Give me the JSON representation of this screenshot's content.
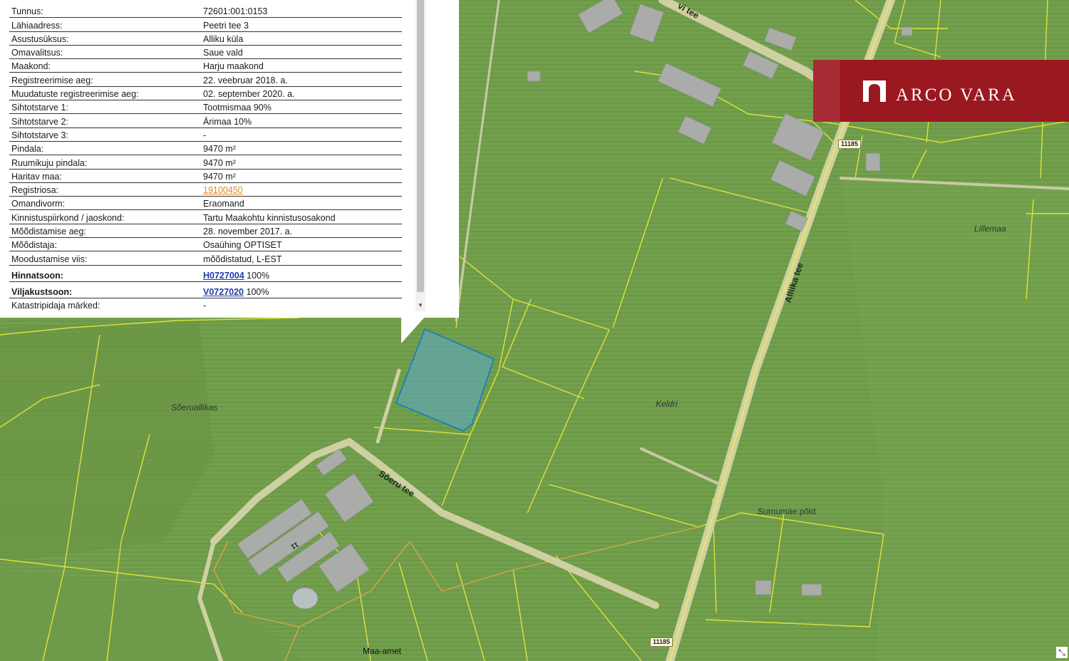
{
  "popup": {
    "rows": [
      {
        "key": "Tunnus:",
        "value": "72601:001:0153"
      },
      {
        "key": "Lähiaadress:",
        "value": "Peetri tee 3"
      },
      {
        "key": "Asustusüksus:",
        "value": "Alliku küla"
      },
      {
        "key": "Omavalitsus:",
        "value": "Saue vald"
      },
      {
        "key": "Maakond:",
        "value": "Harju maakond"
      },
      {
        "key": "Registreerimise aeg:",
        "value": "22. veebruar 2018. a."
      },
      {
        "key": "Muudatuste registreerimise aeg:",
        "value": "02. september 2020. a."
      },
      {
        "key": "Sihtotstarve 1:",
        "value": "Tootmismaa 90%"
      },
      {
        "key": "Sihtotstarve 2:",
        "value": "Ärimaa 10%"
      },
      {
        "key": "Sihtotstarve 3:",
        "value": "-"
      },
      {
        "key": "Pindala:",
        "value": "9470 m²"
      },
      {
        "key": "Ruumikuju pindala:",
        "value": "9470 m²"
      },
      {
        "key": "Haritav maa:",
        "value": "9470 m²"
      },
      {
        "key": "Registriosa:",
        "value": "19100450"
      },
      {
        "key": "Omandivorm:",
        "value": "Eraomand"
      },
      {
        "key": "Kinnistuspiirkond / jaoskond:",
        "value": "Tartu Maakohtu kinnistusosakond"
      },
      {
        "key": "Mõõdistamise aeg:",
        "value": "28. november 2017. a."
      },
      {
        "key": "Mõõdistaja:",
        "value": "Osaühing OPTISET"
      },
      {
        "key": "Moodustamise viis:",
        "value": "mõõdistatud, L-EST"
      },
      {
        "key": "Hinnatsoon:",
        "link": "H0727004",
        "suffix": " 100%"
      },
      {
        "key": "Viljakustsoon:",
        "link": "V0727020",
        "suffix": " 100%"
      },
      {
        "key": "Katastripidaja märked:",
        "value": "-"
      }
    ]
  },
  "logo": {
    "text": "ARCO VARA"
  },
  "map": {
    "labels": {
      "soeruallikas": "Sõeruallikas",
      "keldri": "Keldri",
      "lillemaa": "Lillemaa",
      "surnumae": "Surnumäe põld",
      "alliku_tee": "Alliika tee",
      "soeru_tee": "Sõeru tee",
      "vi_tee": "vi tee",
      "shield_top": "11185",
      "shield_bottom": "11185",
      "building_num": "11"
    },
    "attribution": "Maa-amet",
    "colors": {
      "parcel_fill": "#5fa8b8",
      "parcel_stroke": "#1a7fc0",
      "boundary": "#e0e23a",
      "road": "#d8d7b0",
      "building": "#a9aca8"
    }
  }
}
